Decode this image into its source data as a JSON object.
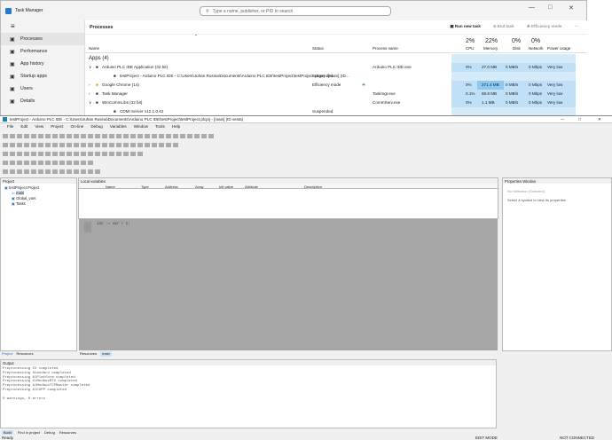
{
  "task_manager": {
    "title": "Task Manager",
    "search_placeholder": "Type a name, publisher, or PID to search",
    "nav": [
      "Processes",
      "Performance",
      "App history",
      "Startup apps",
      "Users",
      "Details"
    ],
    "nav_icons": [
      "processes-icon",
      "performance-icon",
      "app-history-icon",
      "startup-apps-icon",
      "users-icon",
      "details-icon"
    ],
    "page_title": "Processes",
    "tools": {
      "run_new_task": "Run new task",
      "end_task": "End task",
      "efficiency_mode": "Efficiency mode"
    },
    "columns": {
      "name": "Name",
      "status": "Status",
      "process_name": "Process name",
      "cpu_pct": "2%",
      "cpu": "CPU",
      "mem_pct": "22%",
      "memory": "Memory",
      "disk_pct": "0%",
      "disk": "Disk",
      "net_pct": "0%",
      "network": "Network",
      "power": "Power usage"
    },
    "group_title": "Apps (4)",
    "rows": [
      {
        "name": "Arduino PLC IDE Application (32 bit)",
        "status": "",
        "process": "Arduino PLC IDE.exe",
        "cpu": "0%",
        "mem": "27.0 MB",
        "disk": "0 MB/s",
        "net": "0 Mbps",
        "power": "Very low",
        "indent": 1,
        "chev": "v"
      },
      {
        "name": "testProject - Arduino PLC IDE - C:\\Users\\Juhan Rusina\\Documents\\Arduino PLC IDE\\testProject\\testProject.plcprj - [main] (ID...",
        "status": "Suspended",
        "process": "",
        "cpu": "",
        "mem": "",
        "disk": "",
        "net": "",
        "power": "",
        "indent": 2,
        "chev": ""
      },
      {
        "name": "Google Chrome (14)",
        "status": "Efficiency mode",
        "process": "",
        "cpu": "0%",
        "mem": "271.4 MB",
        "disk": "0 MB/s",
        "net": "0 Mbps",
        "power": "Very low",
        "indent": 1,
        "chev": ">"
      },
      {
        "name": "Task Manager",
        "status": "",
        "process": "Taskmgr.exe",
        "cpu": "0.1%",
        "mem": "68.8 MB",
        "disk": "0 MB/s",
        "net": "0 Mbps",
        "power": "Very low",
        "indent": 1,
        "chev": ">"
      },
      {
        "name": "WinCommLibs (32 bit)",
        "status": "",
        "process": "CommServ.exe",
        "cpu": "0%",
        "mem": "1.1 MB",
        "disk": "0 MB/s",
        "net": "0 Mbps",
        "power": "Very low",
        "indent": 1,
        "chev": "v"
      },
      {
        "name": "CDMI Server v12.1.0.42",
        "status": "Suspended",
        "process": "",
        "cpu": "",
        "mem": "",
        "disk": "",
        "net": "",
        "power": "",
        "indent": 2,
        "chev": ""
      }
    ]
  },
  "ide": {
    "title": "testProject - Arduino PLC IDE - C:\\Users\\Juhan Rusina\\Documents\\Arduino PLC IDE\\testProject\\testProject.plcprj - [main] (ID vesta)",
    "menu": [
      "File",
      "Edit",
      "View",
      "Project",
      "On-line",
      "Debug",
      "Variables",
      "Window",
      "Tools",
      "Help"
    ],
    "project_pane": "Project",
    "tree": [
      "testProject Project",
      "main",
      "Global_vars",
      "Tasks"
    ],
    "local_vars": "Local variables",
    "var_columns": [
      "Name",
      "Type",
      "Address",
      "Array",
      "Init value",
      "Attribute",
      "Description"
    ],
    "code_lines": [
      "int := var + 1;"
    ],
    "properties": "Properties Window",
    "no_selection": "No Selection (Selected)",
    "select_hint": "Select a symbol to view its properties",
    "tabs_left": [
      "Project",
      "Resources"
    ],
    "tabs_mid": [
      "Resources",
      "main"
    ],
    "output": "Output",
    "output_lines": [
      "Preprocessing IO completed",
      "Preprocessing Standard completed",
      "Preprocessing AlPlatform completed",
      "Preprocessing AlModbusRTU completed",
      "Preprocessing AlModbusTCPMaster completed",
      "Preprocessing AlCOPP completed",
      "",
      "0 warnings, 0 errors"
    ],
    "bottom_tabs": [
      "Build",
      "Find in project",
      "Debug",
      "Resources"
    ],
    "status_ready": "Ready",
    "status_edit": "EDIT MODE",
    "status_conn": "NOT CONNECTED"
  }
}
